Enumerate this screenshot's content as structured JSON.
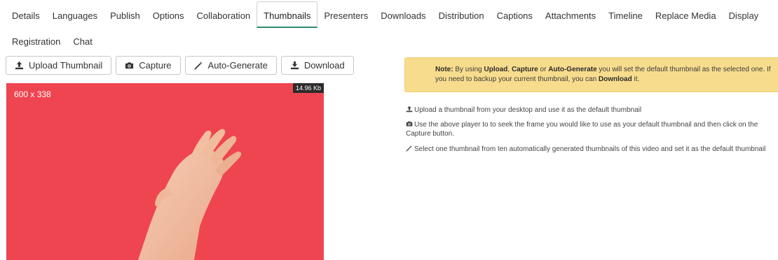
{
  "tabs_row1": [
    "Details",
    "Languages",
    "Publish",
    "Options",
    "Collaboration",
    "Thumbnails",
    "Presenters",
    "Downloads",
    "Distribution",
    "Captions",
    "Attachments",
    "Timeline",
    "Replace Media",
    "Display"
  ],
  "tabs_row2": [
    "Registration",
    "Chat"
  ],
  "active_tab": "Thumbnails",
  "toolbar": {
    "upload_label": "Upload Thumbnail",
    "capture_label": "Capture",
    "autogen_label": "Auto-Generate",
    "download_label": "Download"
  },
  "thumbnail": {
    "dimensions": "600 x 338",
    "file_size": "14.96 Kb",
    "background_color": "#ef4550"
  },
  "note": {
    "prefix": "Note:",
    "t1": " By using ",
    "upload": "Upload",
    "t2": ", ",
    "capture": "Capture",
    "t3": " or ",
    "autogen": "Auto-Generate",
    "t4": " you will set the default thumbnail as the selected one. If you need to backup your current thumbnail, you can ",
    "download": "Download",
    "t5": " it."
  },
  "help": {
    "upload": "Upload a thumbnail from your desktop and use it as the default thumbnail",
    "capture": "Use the above player to to seek the frame you would like to use as your default thumbnail and then click on the Capture button.",
    "autogen": "Select one thumbnail from ten automatically generated thumbnails of this video and set it as the default thumbnail"
  },
  "colors": {
    "accent": "#2d8a6e",
    "note_bg": "#f7dc8d"
  },
  "icons": {
    "upload": "upload-icon",
    "capture": "camera-icon",
    "autogen": "magic-wand-icon",
    "download": "download-icon"
  }
}
